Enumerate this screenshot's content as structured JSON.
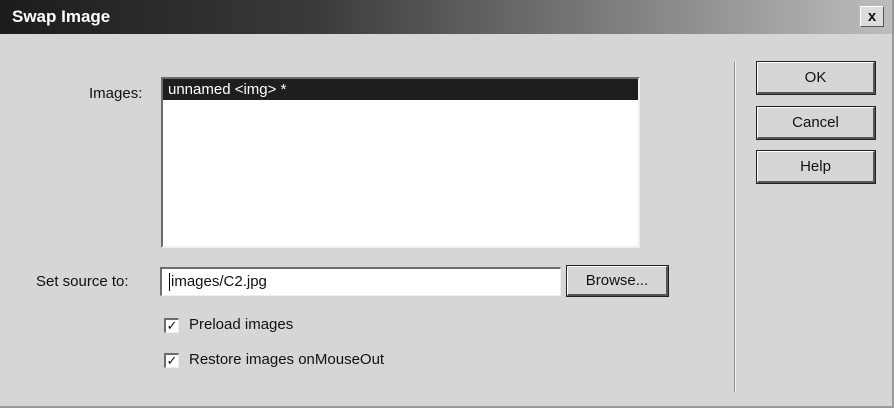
{
  "window": {
    "title": "Swap Image",
    "close_glyph": "x"
  },
  "images_label": "Images:",
  "images_list": [
    {
      "label": "unnamed <img> *",
      "selected": true
    }
  ],
  "source_label": "Set source to:",
  "source_value": "images/C2.jpg",
  "browse_label": "Browse...",
  "preload": {
    "label": "Preload images",
    "checked": true,
    "mark": "✓"
  },
  "restore": {
    "label": "Restore images onMouseOut",
    "checked": true,
    "mark": "✓"
  },
  "buttons": {
    "ok": "OK",
    "cancel": "Cancel",
    "help": "Help"
  },
  "colors": {
    "selection": "#1e1e1e",
    "dialog_bg": "#d6d6d6"
  }
}
